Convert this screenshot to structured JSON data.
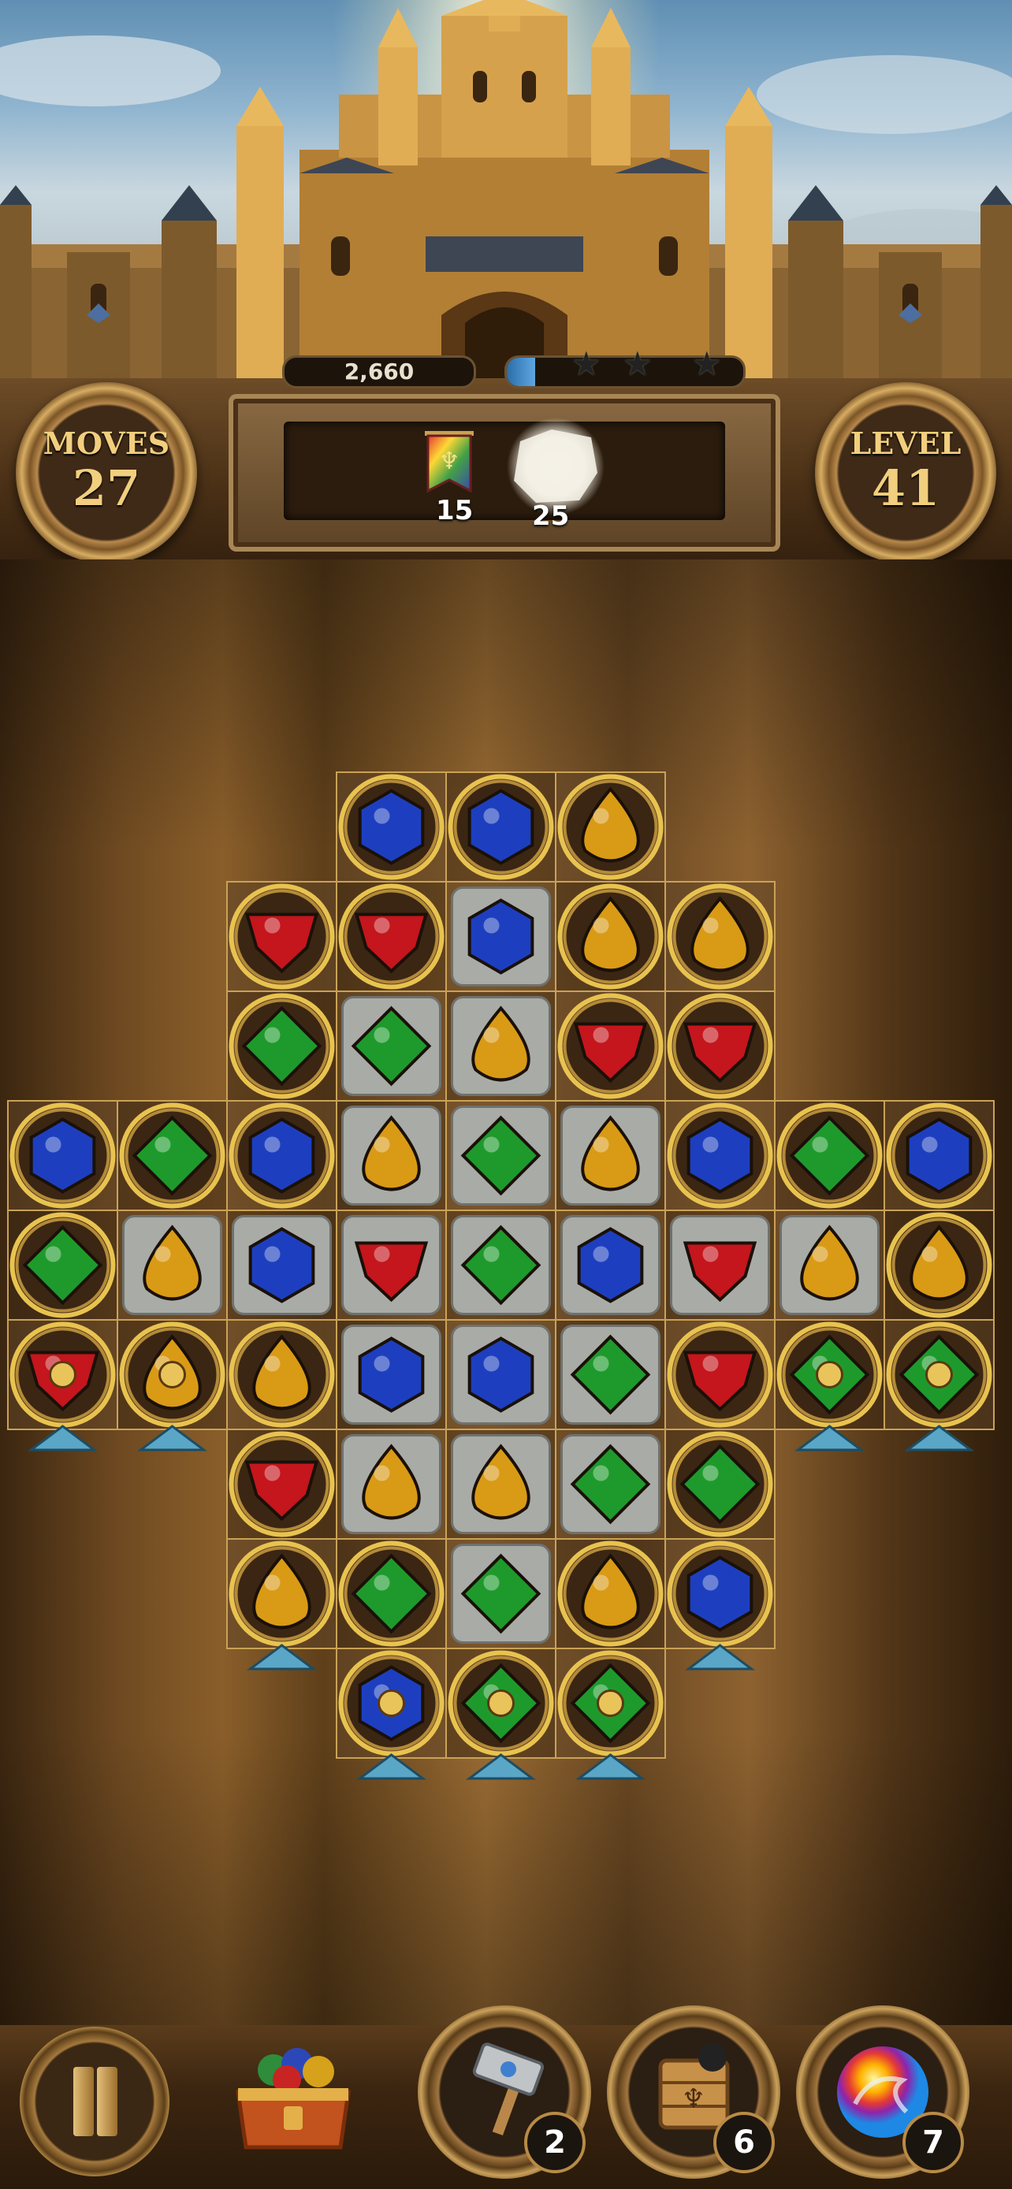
{
  "hud": {
    "moves_label": "MOVES",
    "moves_value": "27",
    "level_label": "LEVEL",
    "level_value": "41",
    "score": "2,660",
    "star_progress": 0.12,
    "stars_earned": 0,
    "stars_total": 3
  },
  "goals": [
    {
      "icon": "rainbow-banner-icon",
      "count": "15"
    },
    {
      "icon": "white-stone-icon",
      "count": "25"
    }
  ],
  "board": {
    "rows": [
      [
        "-",
        "-",
        "-",
        "B",
        "B",
        "Y",
        "-",
        "-",
        "-"
      ],
      [
        "-",
        "-",
        "R",
        "R",
        "B",
        "Y",
        "Y",
        "-",
        "-"
      ],
      [
        "-",
        "-",
        "G",
        "G",
        "Y",
        "R",
        "R",
        "-",
        "-"
      ],
      [
        "B",
        "G",
        "B",
        "Y",
        "G",
        "Y",
        "B",
        "G",
        "B"
      ],
      [
        "G",
        "Y",
        "B",
        "R",
        "G",
        "B",
        "R",
        "Y",
        "Y"
      ],
      [
        "r",
        "y",
        "Y",
        "B",
        "B",
        "G",
        "R",
        "g",
        "g"
      ],
      [
        "-",
        "-",
        "R",
        "Y",
        "Y",
        "G",
        "G",
        "-",
        "-"
      ],
      [
        "-",
        "-",
        "Y",
        "G",
        "G",
        "Y",
        "B",
        "-",
        "-"
      ],
      [
        "-",
        "-",
        "-",
        "b",
        "g",
        "g",
        "-",
        "-",
        "-"
      ]
    ],
    "gem_colors": {
      "R": "#c4161c",
      "G": "#1e9a2c",
      "B": "#1d3fbf",
      "Y": "#d99a16"
    },
    "stone_cells": [
      [
        1,
        4
      ],
      [
        2,
        3
      ],
      [
        2,
        4
      ],
      [
        3,
        3
      ],
      [
        3,
        4
      ],
      [
        3,
        5
      ],
      [
        4,
        1
      ],
      [
        4,
        2
      ],
      [
        4,
        3
      ],
      [
        4,
        4
      ],
      [
        4,
        5
      ],
      [
        4,
        6
      ],
      [
        4,
        7
      ],
      [
        5,
        3
      ],
      [
        5,
        4
      ],
      [
        5,
        5
      ],
      [
        6,
        3
      ],
      [
        6,
        4
      ],
      [
        6,
        5
      ],
      [
        7,
        4
      ]
    ],
    "drop_columns_row5": [
      0,
      1,
      7,
      8
    ],
    "drop_columns_row7": [
      2,
      6
    ],
    "drop_columns_row8": [
      3,
      4,
      5
    ]
  },
  "boosters": [
    {
      "icon": "hammer-icon",
      "count": "2"
    },
    {
      "icon": "bomb-crate-icon",
      "count": "6"
    },
    {
      "icon": "rainbow-orb-icon",
      "count": "7"
    }
  ]
}
